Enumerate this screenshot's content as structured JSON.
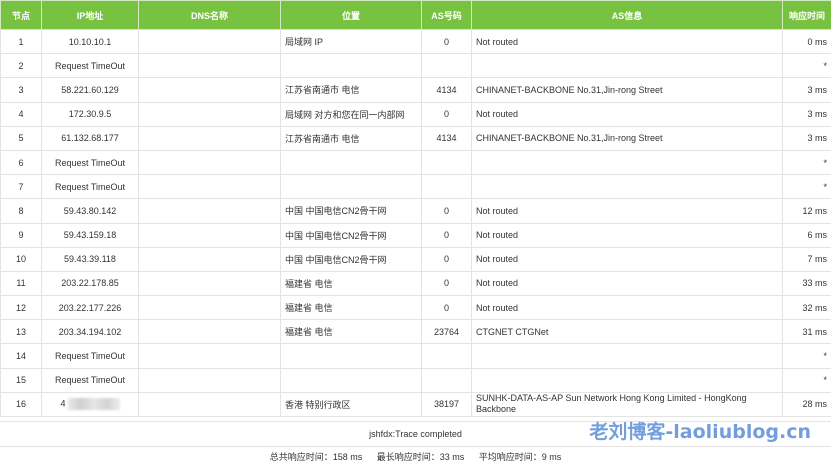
{
  "headers": {
    "node": "节点",
    "ip": "IP地址",
    "dns": "DNS名称",
    "location": "位置",
    "asn": "AS号码",
    "as_info": "AS信息",
    "time": "响应时间"
  },
  "hops": [
    {
      "node": "1",
      "ip": "10.10.10.1",
      "dns": "",
      "location": "局域网 IP",
      "asn": "0",
      "as_info": "Not routed",
      "time": "0 ms"
    },
    {
      "node": "2",
      "ip": "Request TimeOut",
      "dns": "",
      "location": "",
      "asn": "",
      "as_info": "",
      "time": "*"
    },
    {
      "node": "3",
      "ip": "58.221.60.129",
      "dns": "",
      "location": "江苏省南通市 电信",
      "asn": "4134",
      "as_info": "CHINANET-BACKBONE No.31,Jin-rong Street",
      "time": "3 ms"
    },
    {
      "node": "4",
      "ip": "172.30.9.5",
      "dns": "",
      "location": "局域网 对方和您在同一内部网",
      "asn": "0",
      "as_info": "Not routed",
      "time": "3 ms"
    },
    {
      "node": "5",
      "ip": "61.132.68.177",
      "dns": "",
      "location": "江苏省南通市 电信",
      "asn": "4134",
      "as_info": "CHINANET-BACKBONE No.31,Jin-rong Street",
      "time": "3 ms"
    },
    {
      "node": "6",
      "ip": "Request TimeOut",
      "dns": "",
      "location": "",
      "asn": "",
      "as_info": "",
      "time": "*"
    },
    {
      "node": "7",
      "ip": "Request TimeOut",
      "dns": "",
      "location": "",
      "asn": "",
      "as_info": "",
      "time": "*"
    },
    {
      "node": "8",
      "ip": "59.43.80.142",
      "dns": "",
      "location": "中国 中国电信CN2骨干网",
      "asn": "0",
      "as_info": "Not routed",
      "time": "12 ms"
    },
    {
      "node": "9",
      "ip": "59.43.159.18",
      "dns": "",
      "location": "中国 中国电信CN2骨干网",
      "asn": "0",
      "as_info": "Not routed",
      "time": "6 ms"
    },
    {
      "node": "10",
      "ip": "59.43.39.118",
      "dns": "",
      "location": "中国 中国电信CN2骨干网",
      "asn": "0",
      "as_info": "Not routed",
      "time": "7 ms"
    },
    {
      "node": "11",
      "ip": "203.22.178.85",
      "dns": "",
      "location": "福建省 电信",
      "asn": "0",
      "as_info": "Not routed",
      "time": "33 ms"
    },
    {
      "node": "12",
      "ip": "203.22.177.226",
      "dns": "",
      "location": "福建省 电信",
      "asn": "0",
      "as_info": "Not routed",
      "time": "32 ms"
    },
    {
      "node": "13",
      "ip": "203.34.194.102",
      "dns": "",
      "location": "福建省 电信",
      "asn": "23764",
      "as_info": "CTGNET CTGNet",
      "time": "31 ms"
    },
    {
      "node": "14",
      "ip": "Request TimeOut",
      "dns": "",
      "location": "",
      "asn": "",
      "as_info": "",
      "time": "*"
    },
    {
      "node": "15",
      "ip": "Request TimeOut",
      "dns": "",
      "location": "",
      "asn": "",
      "as_info": "",
      "time": "*"
    },
    {
      "node": "16",
      "ip": "4",
      "ip_masked": true,
      "dns": "",
      "location": "香港 特别行政区",
      "asn": "38197",
      "as_info": "SUNHK-DATA-AS-AP Sun Network Hong Kong Limited - HongKong Backbone",
      "time": "28 ms"
    }
  ],
  "status_text": "jshfdx:Trace completed",
  "summary": {
    "total_label": "总共响应时间：",
    "total_value": "158 ms",
    "max_label": "最长响应时间：",
    "max_value": "33 ms",
    "avg_label": "平均响应时间：",
    "avg_value": "9 ms"
  },
  "watermark": "老刘博客-laoliublog.cn",
  "colors": {
    "header_bg": "#78c242",
    "header_text": "#ffffff",
    "watermark": "#5a8fd6"
  }
}
